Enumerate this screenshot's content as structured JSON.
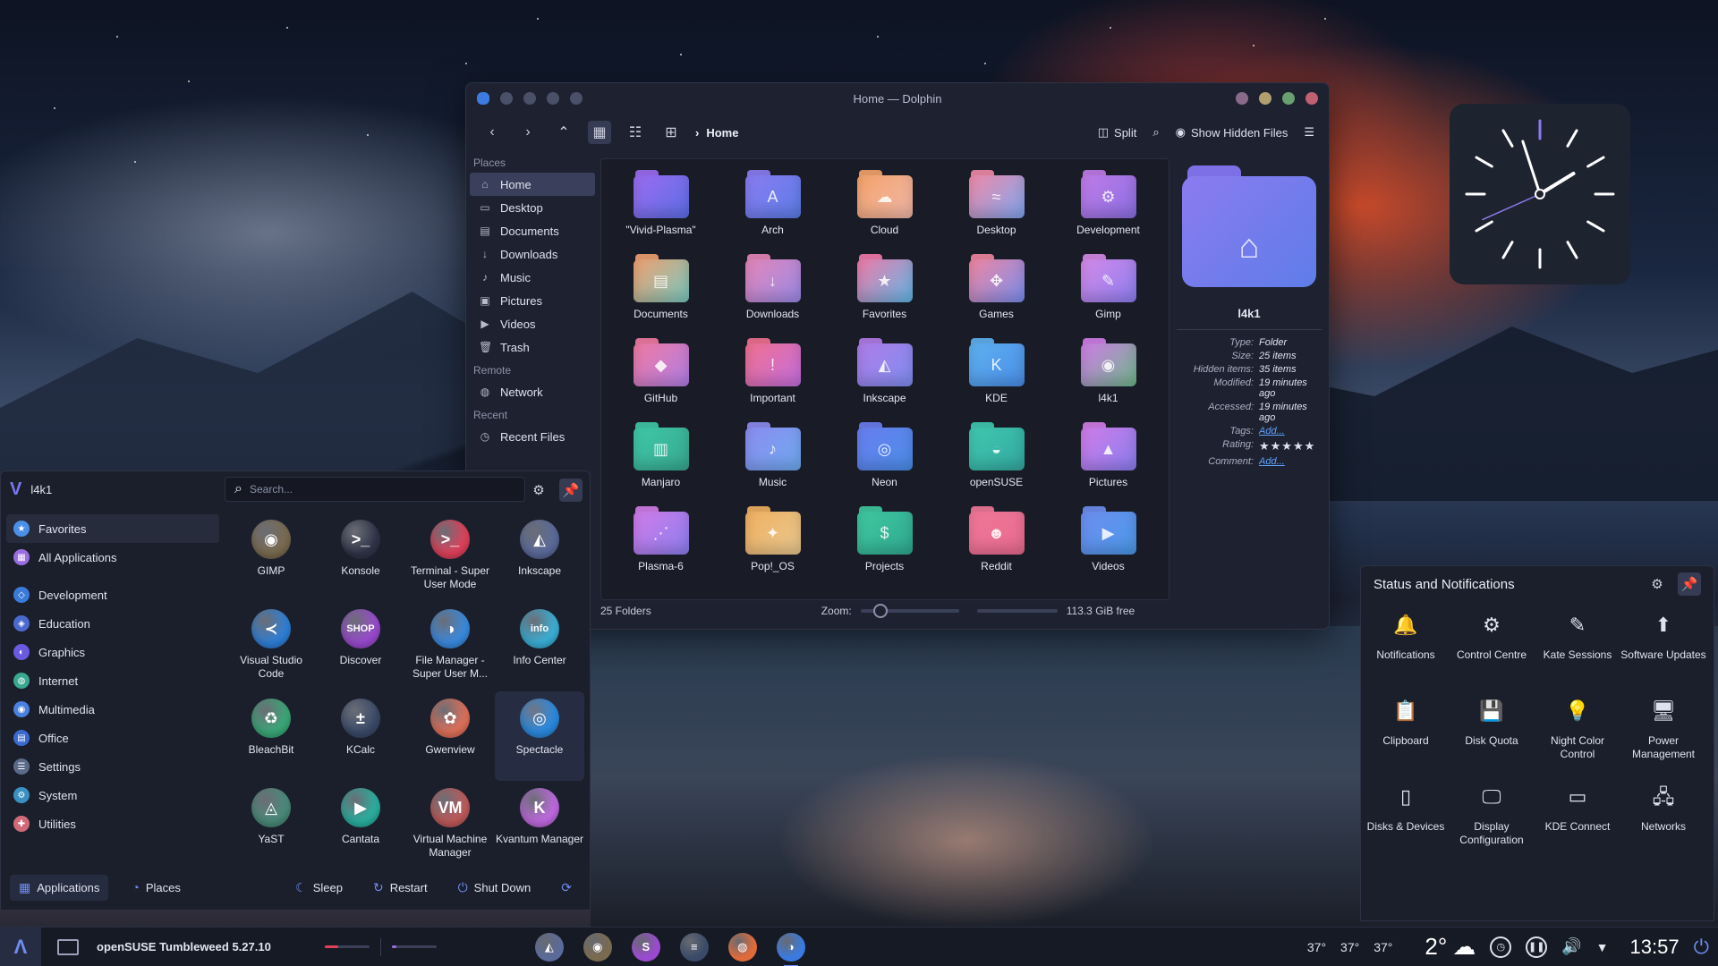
{
  "dolphin": {
    "title": "Home — Dolphin",
    "breadcrumb": "Home",
    "split_label": "Split",
    "hidden_label": "Show Hidden Files",
    "places": {
      "head_places": "Places",
      "head_remote": "Remote",
      "head_recent": "Recent",
      "items": [
        "Home",
        "Desktop",
        "Documents",
        "Downloads",
        "Music",
        "Pictures",
        "Videos",
        "Trash"
      ],
      "remote_items": [
        "Network"
      ],
      "recent_items": [
        "Recent Files"
      ]
    },
    "folders": [
      {
        "name": "\"Vivid-Plasma\"",
        "glyph": "",
        "c1": "#9b6cf0",
        "c2": "#5c6ee6"
      },
      {
        "name": "Arch",
        "glyph": "A",
        "c1": "#8a7cf2",
        "c2": "#5b7de6"
      },
      {
        "name": "Cloud",
        "glyph": "☁",
        "c1": "#f4a36b",
        "c2": "#f0b7a8"
      },
      {
        "name": "Desktop",
        "glyph": "≈",
        "c1": "#f08aa8",
        "c2": "#7fa7f0"
      },
      {
        "name": "Development",
        "glyph": "⚙",
        "c1": "#c07ce8",
        "c2": "#8a6ee0"
      },
      {
        "name": "Documents",
        "glyph": "▤",
        "c1": "#f0a070",
        "c2": "#78c8c0"
      },
      {
        "name": "Downloads",
        "glyph": "↓",
        "c1": "#e486b8",
        "c2": "#9a8ae8"
      },
      {
        "name": "Favorites",
        "glyph": "★",
        "c1": "#f07aa8",
        "c2": "#5fb8e8"
      },
      {
        "name": "Games",
        "glyph": "✥",
        "c1": "#f086a0",
        "c2": "#7a8ef0"
      },
      {
        "name": "Gimp",
        "glyph": "✎",
        "c1": "#d48ae8",
        "c2": "#8c7ef0"
      },
      {
        "name": "GitHub",
        "glyph": "◆",
        "c1": "#f07aa0",
        "c2": "#b07ee8"
      },
      {
        "name": "Important",
        "glyph": "!",
        "c1": "#f0708e",
        "c2": "#c46ee0"
      },
      {
        "name": "Inkscape",
        "glyph": "◭",
        "c1": "#b07ce8",
        "c2": "#7e8ef0"
      },
      {
        "name": "KDE",
        "glyph": "K",
        "c1": "#5fb0f0",
        "c2": "#4a8ee8"
      },
      {
        "name": "l4k1",
        "glyph": "◉",
        "c1": "#d07ce8",
        "c2": "#6eb88a"
      },
      {
        "name": "Manjaro",
        "glyph": "▥",
        "c1": "#3fc8a8",
        "c2": "#38a890"
      },
      {
        "name": "Music",
        "glyph": "♪",
        "c1": "#8c8cf0",
        "c2": "#6eaaf0"
      },
      {
        "name": "Neon",
        "glyph": "◎",
        "c1": "#6a7ef0",
        "c2": "#4a8ee8"
      },
      {
        "name": "openSUSE",
        "glyph": "◒",
        "c1": "#3fc8b0",
        "c2": "#34a8a0"
      },
      {
        "name": "Pictures",
        "glyph": "▲",
        "c1": "#d07ce8",
        "c2": "#8a7ef0"
      },
      {
        "name": "Plasma-6",
        "glyph": "⋰",
        "c1": "#d07ce8",
        "c2": "#8c7ef0"
      },
      {
        "name": "Pop!_OS",
        "glyph": "✦",
        "c1": "#f0b060",
        "c2": "#e8c890"
      },
      {
        "name": "Projects",
        "glyph": "$",
        "c1": "#3fc8a0",
        "c2": "#30a890"
      },
      {
        "name": "Reddit",
        "glyph": "☻",
        "c1": "#f07898",
        "c2": "#e86a8e"
      },
      {
        "name": "Videos",
        "glyph": "▶",
        "c1": "#6e8ef0",
        "c2": "#4a98e8"
      }
    ],
    "status": {
      "folders": "25 Folders",
      "zoom_label": "Zoom:",
      "zoom_fraction": 0.15,
      "free": "113.3 GiB free"
    },
    "info": {
      "name": "l4k1",
      "rows": [
        {
          "k": "Type:",
          "v": "Folder"
        },
        {
          "k": "Size:",
          "v": "25 items"
        },
        {
          "k": "Hidden items:",
          "v": "35 items"
        },
        {
          "k": "Modified:",
          "v": "19 minutes ago"
        },
        {
          "k": "Accessed:",
          "v": "19 minutes ago"
        },
        {
          "k": "Tags:",
          "v": "Add...",
          "link": true
        },
        {
          "k": "Rating:",
          "v": "★★★★★",
          "stars": true
        },
        {
          "k": "Comment:",
          "v": "Add...",
          "link": true
        }
      ]
    }
  },
  "launcher": {
    "user": "l4k1",
    "search_placeholder": "Search...",
    "categories": [
      {
        "label": "Favorites",
        "color": "#4a90e8",
        "glyph": "★"
      },
      {
        "label": "All Applications",
        "color": "#9a6ee0",
        "glyph": "▦"
      },
      {
        "label": "Development",
        "color": "#3a7ad8",
        "glyph": "◇"
      },
      {
        "label": "Education",
        "color": "#4a6ad0",
        "glyph": "◈"
      },
      {
        "label": "Graphics",
        "color": "#6a5ae0",
        "glyph": "◐"
      },
      {
        "label": "Internet",
        "color": "#3aa890",
        "glyph": "◍"
      },
      {
        "label": "Multimedia",
        "color": "#4a80e0",
        "glyph": "◉"
      },
      {
        "label": "Office",
        "color": "#3a6ad0",
        "glyph": "▤"
      },
      {
        "label": "Settings",
        "color": "#5a6a88",
        "glyph": "☰"
      },
      {
        "label": "System",
        "color": "#3a90c0",
        "glyph": "⚙"
      },
      {
        "label": "Utilities",
        "color": "#d06a7a",
        "glyph": "✚"
      }
    ],
    "apps": [
      {
        "label": "GIMP",
        "color": "#7a6a50",
        "glyph": "◉"
      },
      {
        "label": "Konsole",
        "color": "#2e3448",
        "glyph": ">_"
      },
      {
        "label": "Terminal - Super User Mode",
        "color": "#e0405a",
        "glyph": ">_"
      },
      {
        "label": "Inkscape",
        "color": "#5a6a9a",
        "glyph": "◭"
      },
      {
        "label": "Visual Studio Code",
        "color": "#2f7fd8",
        "glyph": "≺"
      },
      {
        "label": "Discover",
        "color": "#9a4ad0",
        "glyph": "SHOP"
      },
      {
        "label": "File Manager - Super User M...",
        "color": "#3a8ae0",
        "glyph": "◑"
      },
      {
        "label": "Info Center",
        "color": "#3ab0d8",
        "glyph": "info"
      },
      {
        "label": "BleachBit",
        "color": "#3aa878",
        "glyph": "♻"
      },
      {
        "label": "KCalc",
        "color": "#3a4a68",
        "glyph": "±"
      },
      {
        "label": "Gwenview",
        "color": "#e0705a",
        "glyph": "✿"
      },
      {
        "label": "Spectacle",
        "color": "#2a8ae0",
        "glyph": "◎"
      },
      {
        "label": "YaST",
        "color": "#4a8a7a",
        "glyph": "◬"
      },
      {
        "label": "Cantata",
        "color": "#2ab0a0",
        "glyph": "▶"
      },
      {
        "label": "Virtual Machine Manager",
        "color": "#c05a5a",
        "glyph": "VM"
      },
      {
        "label": "Kvantum Manager",
        "color": "#c06ae0",
        "glyph": "K"
      }
    ],
    "footer": {
      "applications": "Applications",
      "places": "Places",
      "sleep": "Sleep",
      "restart": "Restart",
      "shutdown": "Shut Down"
    }
  },
  "notifications": {
    "title": "Status and Notifications",
    "tiles": [
      {
        "label": "Notifications",
        "glyph": "🔔"
      },
      {
        "label": "Control Centre",
        "glyph": "⚙"
      },
      {
        "label": "Kate Sessions",
        "glyph": "✎"
      },
      {
        "label": "Software Updates",
        "glyph": "⬆"
      },
      {
        "label": "Clipboard",
        "glyph": "📋"
      },
      {
        "label": "Disk Quota",
        "glyph": "💾"
      },
      {
        "label": "Night Color Control",
        "glyph": "💡"
      },
      {
        "label": "Power Management",
        "glyph": "🖥"
      },
      {
        "label": "Disks & Devices",
        "glyph": "▯"
      },
      {
        "label": "Display Configuration",
        "glyph": "🖵"
      },
      {
        "label": "KDE Connect",
        "glyph": "▭"
      },
      {
        "label": "Networks",
        "glyph": "🖧"
      }
    ]
  },
  "taskbar": {
    "distro": "openSUSE Tumbleweed 5.27.10",
    "meters": [
      {
        "fraction": 0.3,
        "color": "#e0405a"
      },
      {
        "fraction": 0.1,
        "color": "#9a6ee0"
      }
    ],
    "temps": [
      "37°",
      "37°",
      "37°"
    ],
    "weather_temp": "2°",
    "time": "13:57",
    "tasks": [
      {
        "name": "inkscape",
        "color": "#5a6a9a",
        "glyph": "◭"
      },
      {
        "name": "gimp",
        "color": "#7a6a50",
        "glyph": "◉"
      },
      {
        "name": "discover",
        "color": "#9a4ad0",
        "glyph": "S"
      },
      {
        "name": "settings",
        "color": "#3a4a68",
        "glyph": "≡"
      },
      {
        "name": "firefox",
        "color": "#e06a3a",
        "glyph": "◍"
      },
      {
        "name": "dolphin",
        "color": "#3a7ae0",
        "glyph": "◑",
        "active": true
      }
    ]
  }
}
